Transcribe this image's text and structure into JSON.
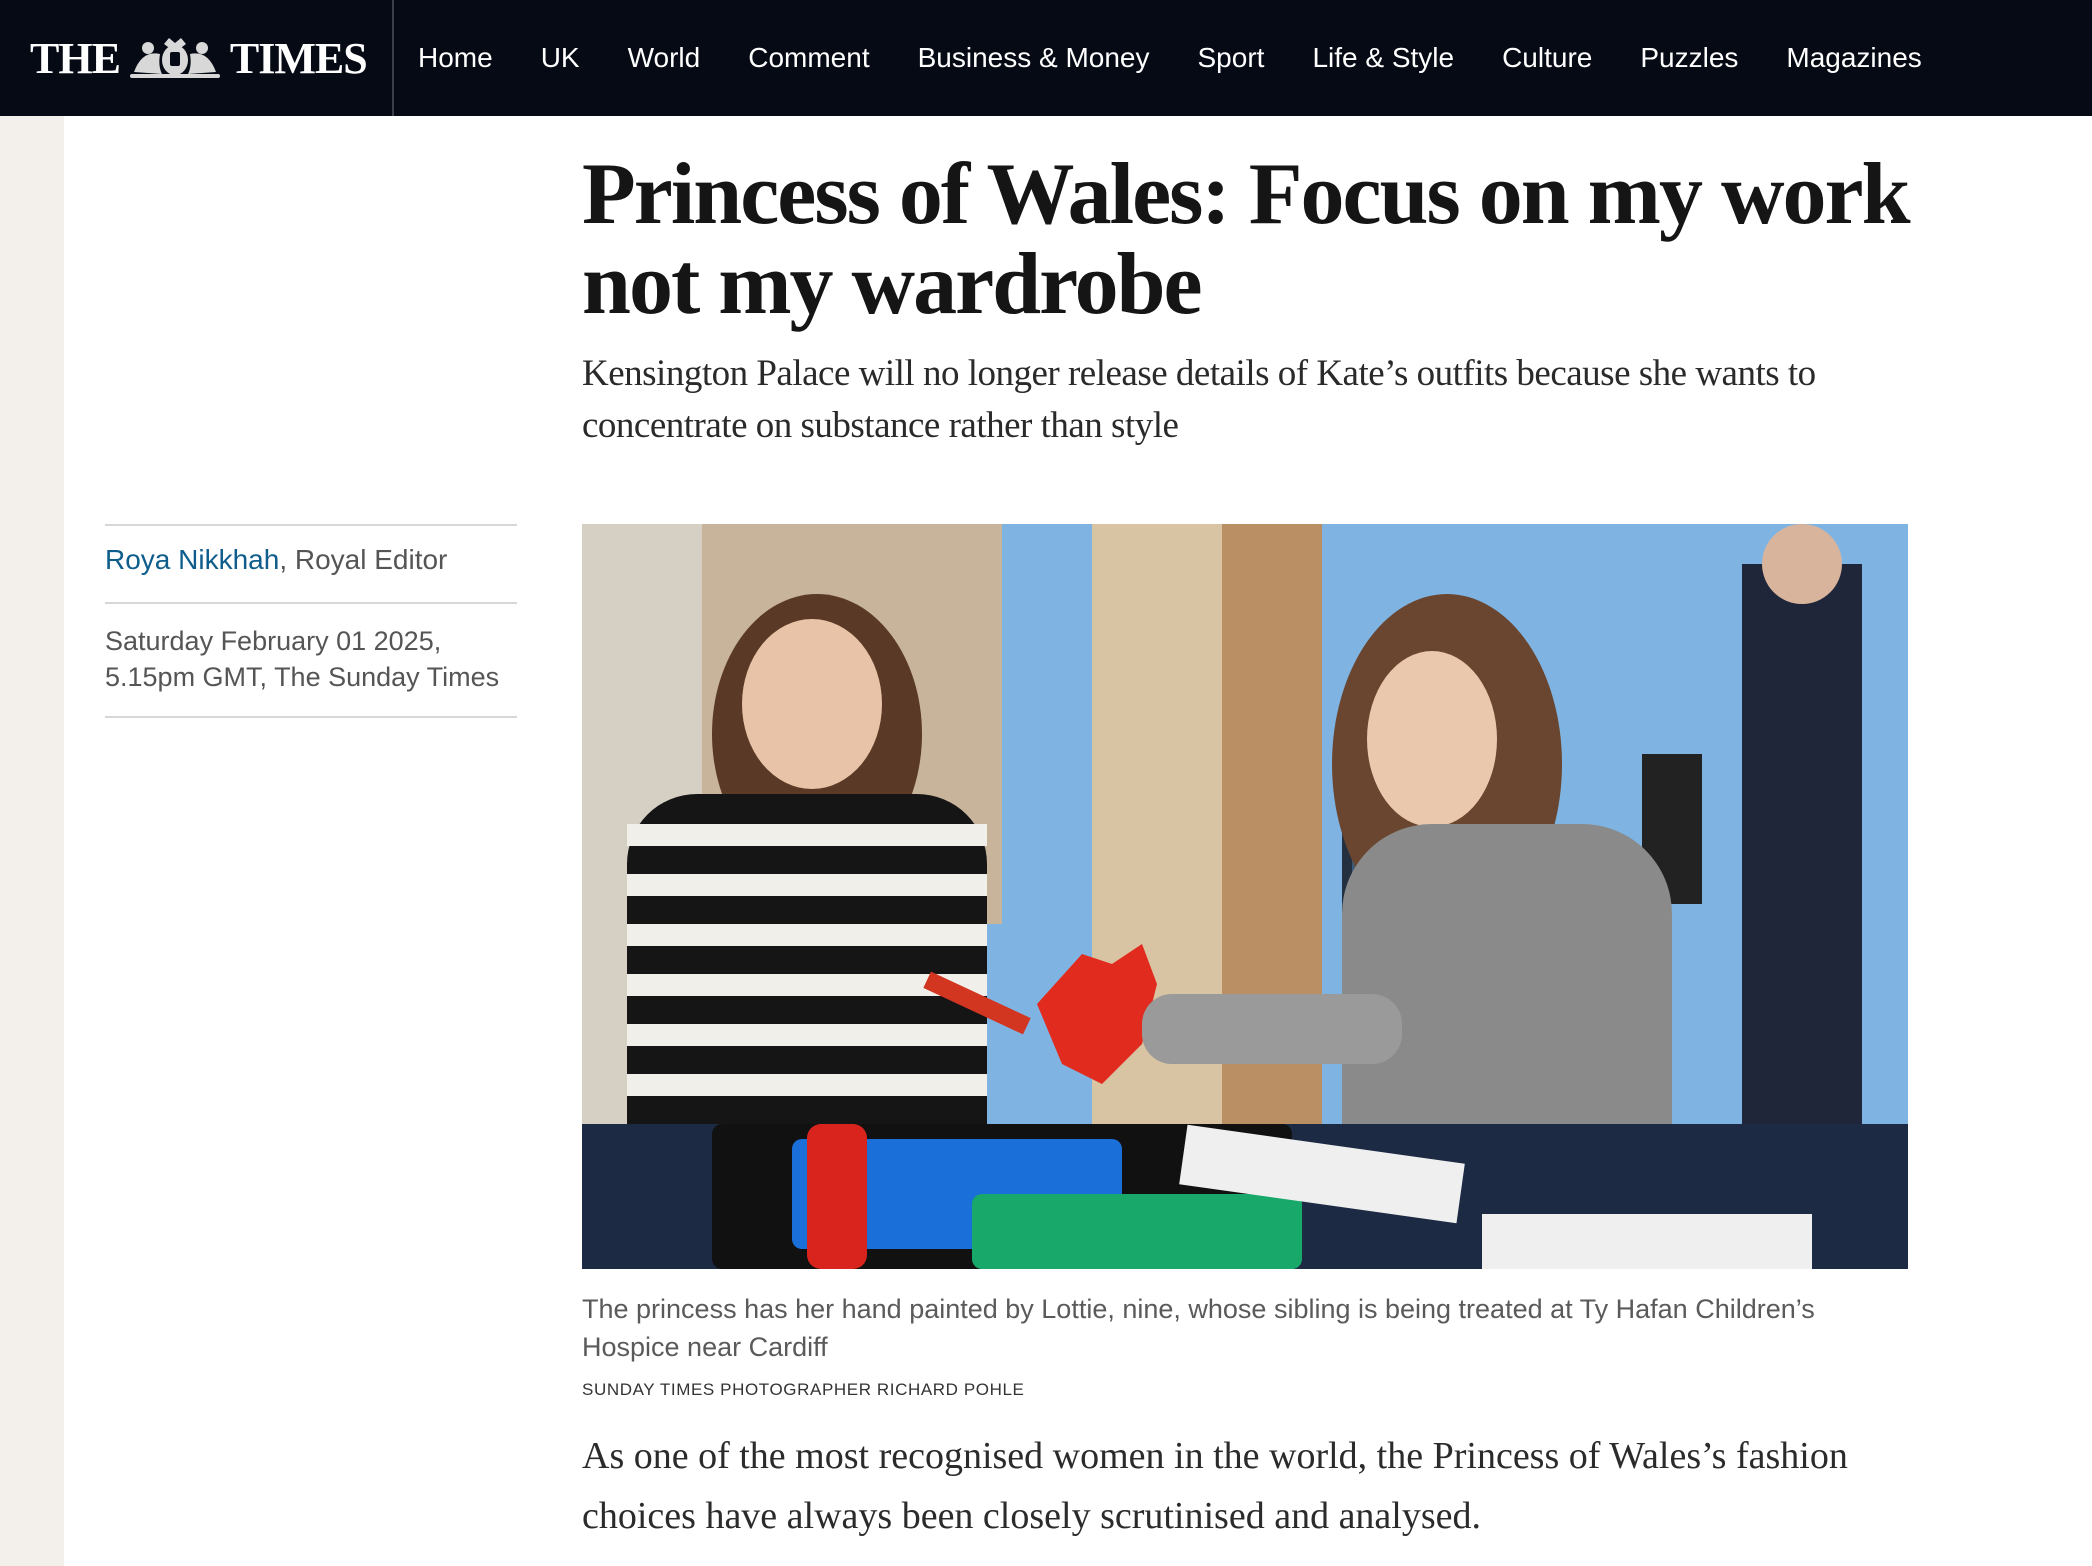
{
  "masthead": {
    "logo_left": "THE",
    "logo_right": "TIMES",
    "crest_icon": "royal-crest-icon"
  },
  "nav": {
    "items": [
      "Home",
      "UK",
      "World",
      "Comment",
      "Business & Money",
      "Sport",
      "Life & Style",
      "Culture",
      "Puzzles",
      "Magazines"
    ]
  },
  "article": {
    "headline": "Princess of Wales: Focus on my work not my wardrobe",
    "standfirst": "Kensington Palace will no longer release details of Kate’s outfits because she wants to concentrate on substance rather than style",
    "author": "Roya Nikkhah",
    "author_role": ", Royal Editor",
    "dateline": "Saturday February 01 2025, 5.15pm GMT, The Sunday Times",
    "caption": "The princess has her hand painted by Lottie, nine, whose sibling is being treated at Ty Hafan Children’s Hospice near Cardiff",
    "credit": "SUNDAY TIMES PHOTOGRAPHER RICHARD POHLE",
    "body_first": "As one of the most recognised women in the world, the Princess of Wales’s fashion choices have always been closely scrutinised and analysed."
  },
  "colors": {
    "nav_bg": "#050a14",
    "author_link": "#0f5d8c",
    "gutter": "#f3efea"
  }
}
